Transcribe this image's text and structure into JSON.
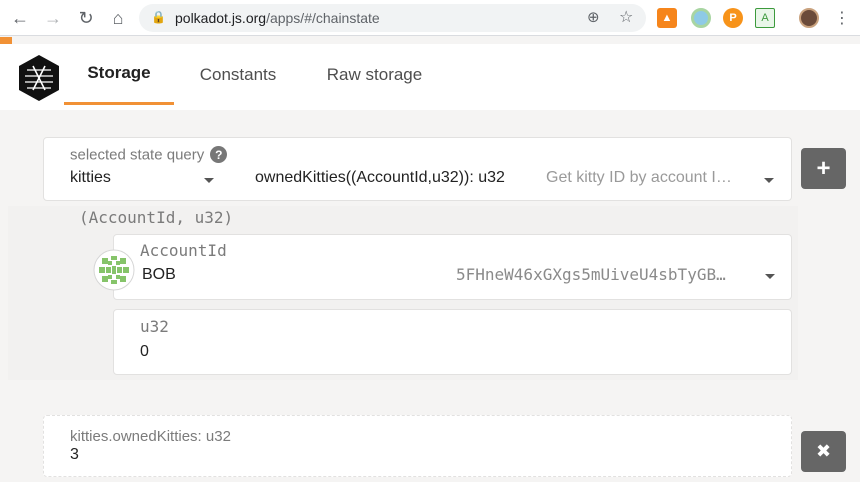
{
  "browser": {
    "url_host": "polkadot.js.org",
    "url_path": "/apps/#/chainstate",
    "icons": [
      "back-icon",
      "forward-icon",
      "reload-icon",
      "home-icon",
      "lock-icon",
      "zoom-icon",
      "star-icon",
      "menu-icon"
    ]
  },
  "app": {
    "tabs": [
      {
        "label": "Storage",
        "active": true
      },
      {
        "label": "Constants",
        "active": false
      },
      {
        "label": "Raw storage",
        "active": false
      }
    ],
    "accent_color": "#f19135"
  },
  "query": {
    "label": "selected state query",
    "module": "kitties",
    "method": "ownedKitties((AccountId,u32)): u32",
    "method_doc": "Get kitty ID by account I…",
    "add_button": "+"
  },
  "params": {
    "tuple_label": "(AccountId, u32)",
    "account_label": "AccountId",
    "account_name": "BOB",
    "account_address": "5FHneW46xGXgs5mUiveU4sbTyGB…",
    "u32_label": "u32",
    "u32_value": "0"
  },
  "result": {
    "label": "kitties.ownedKitties: u32",
    "value": "3",
    "close_button": "✖"
  }
}
